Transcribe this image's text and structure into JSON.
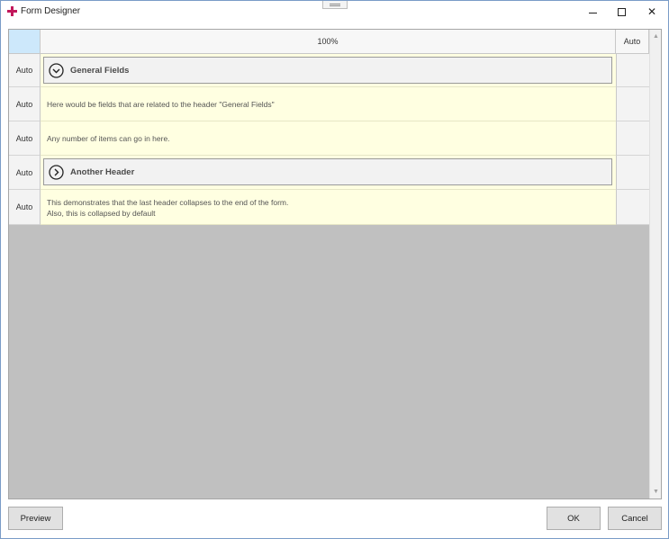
{
  "window": {
    "title": "Form Designer",
    "minimize_icon": "minimize-icon",
    "maximize_icon": "maximize-icon",
    "close_glyph": "✕"
  },
  "grid": {
    "columns": [
      {
        "label": "100%"
      },
      {
        "label": "Auto"
      }
    ],
    "rows": [
      {
        "size_label": "Auto",
        "kind": "header",
        "text": "General Fields",
        "state": "expanded",
        "icon": "chevron-down-circle-icon"
      },
      {
        "size_label": "Auto",
        "kind": "content",
        "lines": [
          "Here would be fields that are related to the header \"General Fields\""
        ]
      },
      {
        "size_label": "Auto",
        "kind": "content",
        "lines": [
          "Any number of items can go in here."
        ]
      },
      {
        "size_label": "Auto",
        "kind": "header",
        "text": "Another Header",
        "state": "collapsed",
        "icon": "chevron-right-circle-icon"
      },
      {
        "size_label": "Auto",
        "kind": "content",
        "lines": [
          "This demonstrates that the last header collapses to the end of the form.",
          "Also, this is collapsed by default"
        ]
      }
    ]
  },
  "buttons": {
    "preview": "Preview",
    "ok": "OK",
    "cancel": "Cancel"
  },
  "colors": {
    "accent_icon": "#c2185b",
    "cell_background": "#ffffe1",
    "corner_highlight": "#cde8fb",
    "empty_area": "#c0c0c0"
  }
}
